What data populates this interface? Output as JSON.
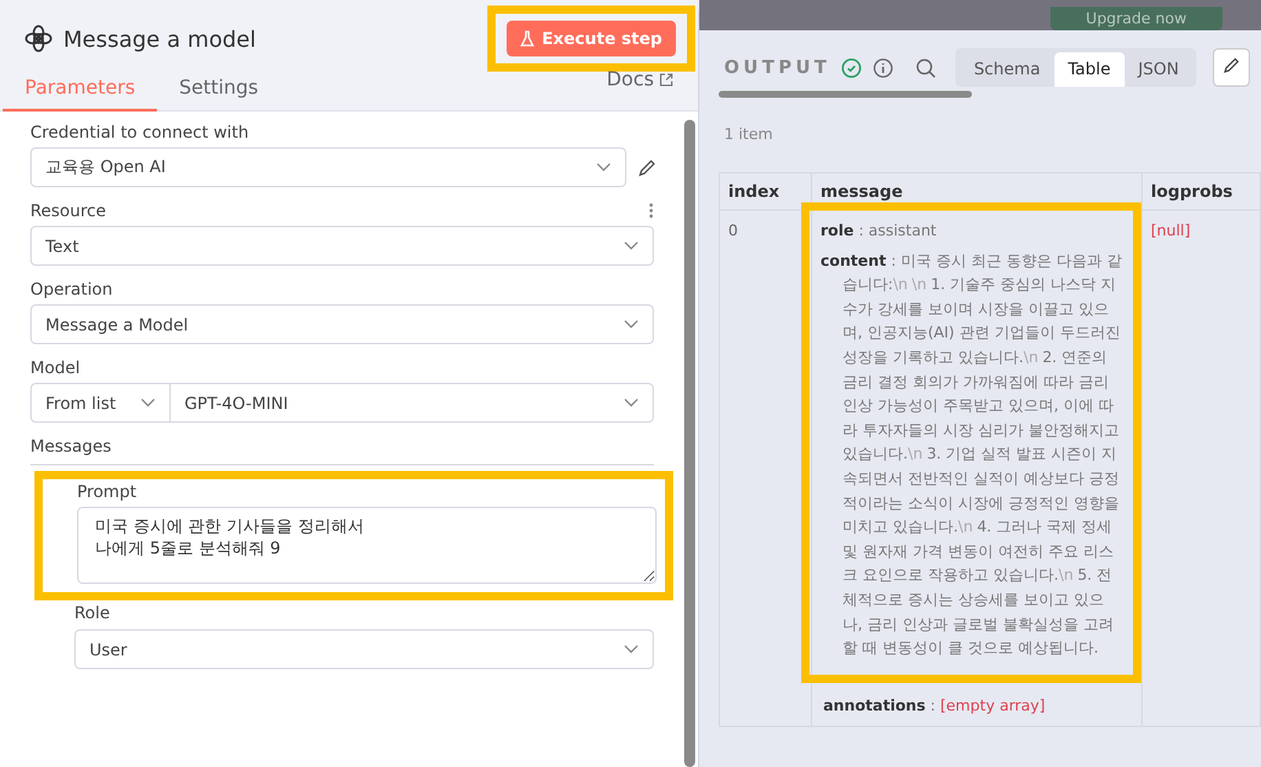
{
  "node": {
    "title": "Message a model",
    "execute_button": "Execute step"
  },
  "tabs": [
    {
      "label": "Parameters",
      "selected": true
    },
    {
      "label": "Settings",
      "selected": false
    }
  ],
  "docs_link": "Docs",
  "fields": [
    {
      "kind": "select",
      "label": "Credential to connect with",
      "value": "교육용 Open AI",
      "editable": true
    },
    {
      "kind": "select",
      "label": "Resource",
      "value": "Text",
      "options_menu": true
    },
    {
      "kind": "select",
      "label": "Operation",
      "value": "Message a Model"
    },
    {
      "kind": "model",
      "label": "Model",
      "mode": "From list",
      "value": "GPT-4O-MINI"
    }
  ],
  "messages": {
    "label": "Messages",
    "prompt_label": "Prompt",
    "prompt_value": "미국 증시에 관한 기사들을 정리해서\n나에게 5줄로 분석해줘 9",
    "role_label": "Role",
    "role_value": "User"
  },
  "upgrade_button": "Upgrade now",
  "output": {
    "label": "OUTPUT",
    "views": [
      {
        "label": "Schema",
        "selected": false
      },
      {
        "label": "Table",
        "selected": true
      },
      {
        "label": "JSON",
        "selected": false
      }
    ],
    "item_count": "1 item",
    "columns": [
      "index",
      "message",
      "logprobs"
    ],
    "row": {
      "index": "0",
      "logprobs": "[null]",
      "message": [
        {
          "key": "role",
          "separator": ":",
          "value": [
            {
              "kind": "text",
              "text": "assistant"
            }
          ]
        },
        {
          "key": "content",
          "separator": ":",
          "value": [
            {
              "kind": "text",
              "text": "미국 증시 최근 동향은 다음과 같습니다:"
            },
            {
              "kind": "escape",
              "text": "\\n"
            },
            {
              "kind": "escape",
              "text": "\\n"
            },
            {
              "kind": "text",
              "text": "1. 기술주 중심의 나스닥 지수가 강세를 보이며 시장을 이끌고 있으며, 인공지능(AI) 관련 기업들이 두드러진 성장을 기록하고 있습니다."
            },
            {
              "kind": "escape",
              "text": "\\n"
            },
            {
              "kind": "text",
              "text": "2. 연준의 금리 결정 회의가 가까워짐에 따라 금리 인상 가능성이 주목받고 있으며, 이에 따라 투자자들의 시장 심리가 불안정해지고 있습니다."
            },
            {
              "kind": "escape",
              "text": "\\n"
            },
            {
              "kind": "text",
              "text": "3. 기업 실적 발표 시즌이 지속되면서 전반적인 실적이 예상보다 긍정적이라는 소식이 시장에 긍정적인 영향을 미치고 있습니다."
            },
            {
              "kind": "escape",
              "text": "\\n"
            },
            {
              "kind": "text",
              "text": "4. 그러나 국제 정세 및 원자재 가격 변동이 여전히 주요 리스크 요인으로 작용하고 있습니다."
            },
            {
              "kind": "escape",
              "text": "\\n"
            },
            {
              "kind": "text",
              "text": "5. 전체적으로 증시는 상승세를 보이고 있으나, 금리 인상과 글로벌 불확실성을 고려할 때 변동성이 클 것으로 예상됩니다."
            }
          ]
        },
        {
          "key": "annotations",
          "separator": ":",
          "value": [
            {
              "kind": "null",
              "text": "[empty array]"
            }
          ]
        }
      ]
    }
  }
}
